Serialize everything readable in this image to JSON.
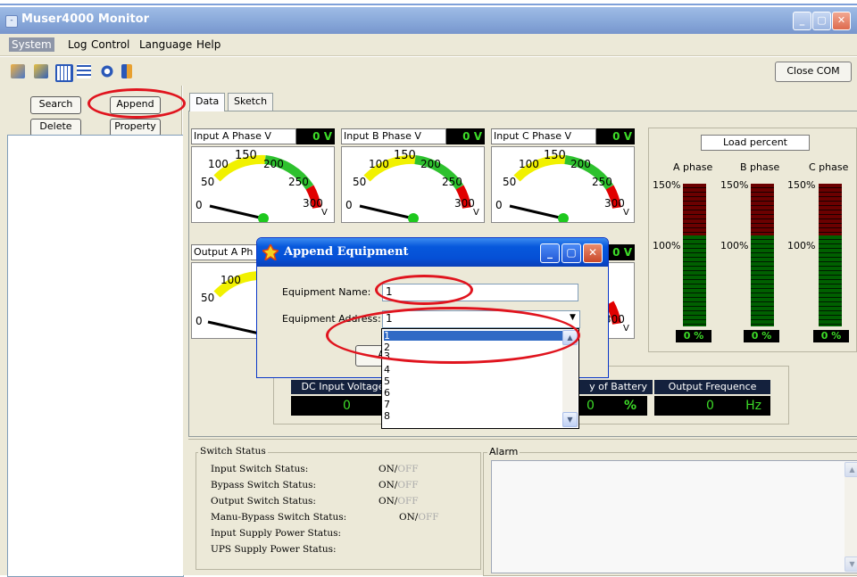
{
  "window": {
    "title": "Muser4000 Monitor",
    "min": "_",
    "max": "▢",
    "close": "✕",
    "sysmenu": "-"
  },
  "menu": [
    "System",
    "Log",
    "Control",
    "Language",
    "Help"
  ],
  "toolbar": {
    "close_com": "Close COM"
  },
  "left": {
    "search": "Search",
    "append": "Append",
    "delete": "Delete",
    "property": "Property"
  },
  "tabs": [
    "Data",
    "Sketch Map"
  ],
  "meters": {
    "input_a": {
      "label": "Input A Phase V",
      "value": "0 V"
    },
    "input_b": {
      "label": "Input B Phase V",
      "value": "0 V"
    },
    "input_c": {
      "label": "Input C Phase V",
      "value": "0 V"
    },
    "output_a": {
      "label": "Output A Ph",
      "value": "0 V"
    },
    "output_right": {
      "value": "0 V"
    },
    "scale": [
      "0",
      "50",
      "100",
      "150",
      "200",
      "250",
      "300"
    ],
    "unit": "V"
  },
  "load": {
    "title": "Load percent",
    "phases": [
      "A phase",
      "B phase",
      "C phase"
    ],
    "p150": "150%",
    "p100": "100%",
    "values": [
      "0 %",
      "0 %",
      "0 %"
    ]
  },
  "dc": {
    "labels": [
      "DC Input Voltage",
      "y of Battery",
      "Output Frequence"
    ],
    "values": [
      "0",
      "0",
      "0"
    ],
    "units": [
      "%",
      "Hz"
    ]
  },
  "switch_status": {
    "title": "Switch Status",
    "rows": [
      "Input Switch Status:",
      "Bypass Switch Status:",
      "Output Switch Status:",
      "Manu-Bypass Switch Status:",
      "Input Supply Power Status:",
      "UPS Supply Power Status:"
    ],
    "on": "ON",
    "sep": "/",
    "off": "OFF"
  },
  "alarm": {
    "title": "Alarm"
  },
  "dialog": {
    "title": "Append Equipment",
    "name_label": "Equipment Name:",
    "name_value": "1",
    "address_label": "Equipment Address:",
    "address_value": "1",
    "button_partial": "App",
    "options": [
      "1",
      "2",
      "3",
      "4",
      "5",
      "6",
      "7",
      "8"
    ],
    "selected": "1"
  }
}
